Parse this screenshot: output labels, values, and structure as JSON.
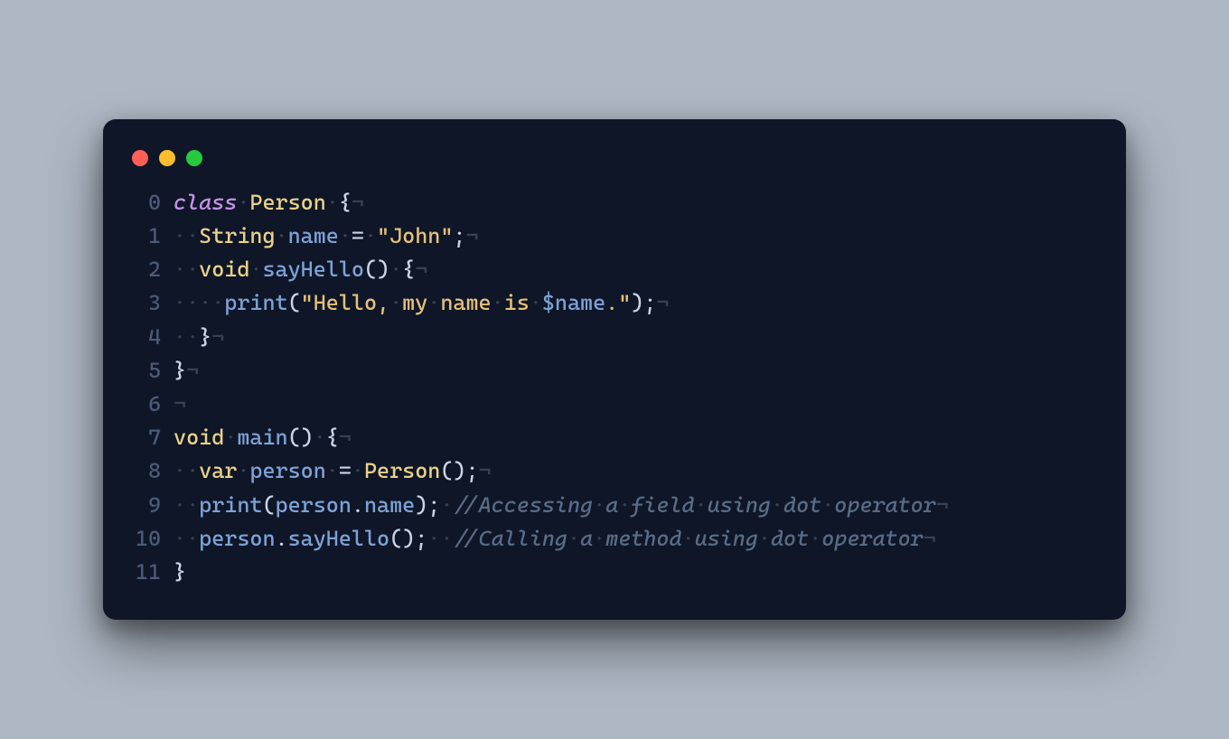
{
  "window": {
    "dots": [
      "red",
      "yellow",
      "green"
    ]
  },
  "glyphs": {
    "dot": "·",
    "nl": "¬"
  },
  "lineNumbers": [
    "0",
    "1",
    "2",
    "3",
    "4",
    "5",
    "6",
    "7",
    "8",
    "9",
    "10",
    "11"
  ],
  "code": [
    [
      {
        "t": "kw",
        "v": "class"
      },
      {
        "t": "ws",
        "v": "·"
      },
      {
        "t": "type",
        "v": "Person"
      },
      {
        "t": "ws",
        "v": "·"
      },
      {
        "t": "punc",
        "v": "{"
      },
      {
        "t": "ws",
        "v": "¬"
      }
    ],
    [
      {
        "t": "ws",
        "v": "··"
      },
      {
        "t": "type",
        "v": "String"
      },
      {
        "t": "ws",
        "v": "·"
      },
      {
        "t": "ident",
        "v": "name"
      },
      {
        "t": "ws",
        "v": "·"
      },
      {
        "t": "op",
        "v": "="
      },
      {
        "t": "ws",
        "v": "·"
      },
      {
        "t": "str",
        "v": "\"John\""
      },
      {
        "t": "punc",
        "v": ";"
      },
      {
        "t": "ws",
        "v": "¬"
      }
    ],
    [
      {
        "t": "ws",
        "v": "··"
      },
      {
        "t": "type",
        "v": "void"
      },
      {
        "t": "ws",
        "v": "·"
      },
      {
        "t": "fn",
        "v": "sayHello"
      },
      {
        "t": "punc",
        "v": "()"
      },
      {
        "t": "ws",
        "v": "·"
      },
      {
        "t": "punc",
        "v": "{"
      },
      {
        "t": "ws",
        "v": "¬"
      }
    ],
    [
      {
        "t": "ws",
        "v": "····"
      },
      {
        "t": "fn",
        "v": "print"
      },
      {
        "t": "punc",
        "v": "("
      },
      {
        "t": "str",
        "v": "\"Hello,"
      },
      {
        "t": "ws",
        "v": "·"
      },
      {
        "t": "str",
        "v": "my"
      },
      {
        "t": "ws",
        "v": "·"
      },
      {
        "t": "str",
        "v": "name"
      },
      {
        "t": "ws",
        "v": "·"
      },
      {
        "t": "str",
        "v": "is"
      },
      {
        "t": "ws",
        "v": "·"
      },
      {
        "t": "interp",
        "v": "$name"
      },
      {
        "t": "str",
        "v": ".\""
      },
      {
        "t": "punc",
        "v": ");"
      },
      {
        "t": "ws",
        "v": "¬"
      }
    ],
    [
      {
        "t": "ws",
        "v": "··"
      },
      {
        "t": "punc",
        "v": "}"
      },
      {
        "t": "ws",
        "v": "¬"
      }
    ],
    [
      {
        "t": "punc",
        "v": "}"
      },
      {
        "t": "ws",
        "v": "¬"
      }
    ],
    [
      {
        "t": "ws",
        "v": "¬"
      }
    ],
    [
      {
        "t": "type",
        "v": "void"
      },
      {
        "t": "ws",
        "v": "·"
      },
      {
        "t": "fn",
        "v": "main"
      },
      {
        "t": "punc",
        "v": "()"
      },
      {
        "t": "ws",
        "v": "·"
      },
      {
        "t": "punc",
        "v": "{"
      },
      {
        "t": "ws",
        "v": "¬"
      }
    ],
    [
      {
        "t": "ws",
        "v": "··"
      },
      {
        "t": "type",
        "v": "var"
      },
      {
        "t": "ws",
        "v": "·"
      },
      {
        "t": "ident",
        "v": "person"
      },
      {
        "t": "ws",
        "v": "·"
      },
      {
        "t": "op",
        "v": "="
      },
      {
        "t": "ws",
        "v": "·"
      },
      {
        "t": "type",
        "v": "Person"
      },
      {
        "t": "punc",
        "v": "();"
      },
      {
        "t": "ws",
        "v": "¬"
      }
    ],
    [
      {
        "t": "ws",
        "v": "··"
      },
      {
        "t": "fn",
        "v": "print"
      },
      {
        "t": "punc",
        "v": "("
      },
      {
        "t": "ident",
        "v": "person"
      },
      {
        "t": "punc",
        "v": "."
      },
      {
        "t": "ident",
        "v": "name"
      },
      {
        "t": "punc",
        "v": ");"
      },
      {
        "t": "ws",
        "v": "·"
      },
      {
        "t": "cmt",
        "v": "//Accessing"
      },
      {
        "t": "ws",
        "v": "·"
      },
      {
        "t": "cmt",
        "v": "a"
      },
      {
        "t": "ws",
        "v": "·"
      },
      {
        "t": "cmt",
        "v": "field"
      },
      {
        "t": "ws",
        "v": "·"
      },
      {
        "t": "cmt",
        "v": "using"
      },
      {
        "t": "ws",
        "v": "·"
      },
      {
        "t": "cmt",
        "v": "dot"
      },
      {
        "t": "ws",
        "v": "·"
      },
      {
        "t": "cmt",
        "v": "operator"
      },
      {
        "t": "ws",
        "v": "¬"
      }
    ],
    [
      {
        "t": "ws",
        "v": "··"
      },
      {
        "t": "ident",
        "v": "person"
      },
      {
        "t": "punc",
        "v": "."
      },
      {
        "t": "fn",
        "v": "sayHello"
      },
      {
        "t": "punc",
        "v": "();"
      },
      {
        "t": "ws",
        "v": "··"
      },
      {
        "t": "cmt",
        "v": "//Calling"
      },
      {
        "t": "ws",
        "v": "·"
      },
      {
        "t": "cmt",
        "v": "a"
      },
      {
        "t": "ws",
        "v": "·"
      },
      {
        "t": "cmt",
        "v": "method"
      },
      {
        "t": "ws",
        "v": "·"
      },
      {
        "t": "cmt",
        "v": "using"
      },
      {
        "t": "ws",
        "v": "·"
      },
      {
        "t": "cmt",
        "v": "dot"
      },
      {
        "t": "ws",
        "v": "·"
      },
      {
        "t": "cmt",
        "v": "operator"
      },
      {
        "t": "ws",
        "v": "¬"
      }
    ],
    [
      {
        "t": "punc",
        "v": "}"
      }
    ]
  ]
}
